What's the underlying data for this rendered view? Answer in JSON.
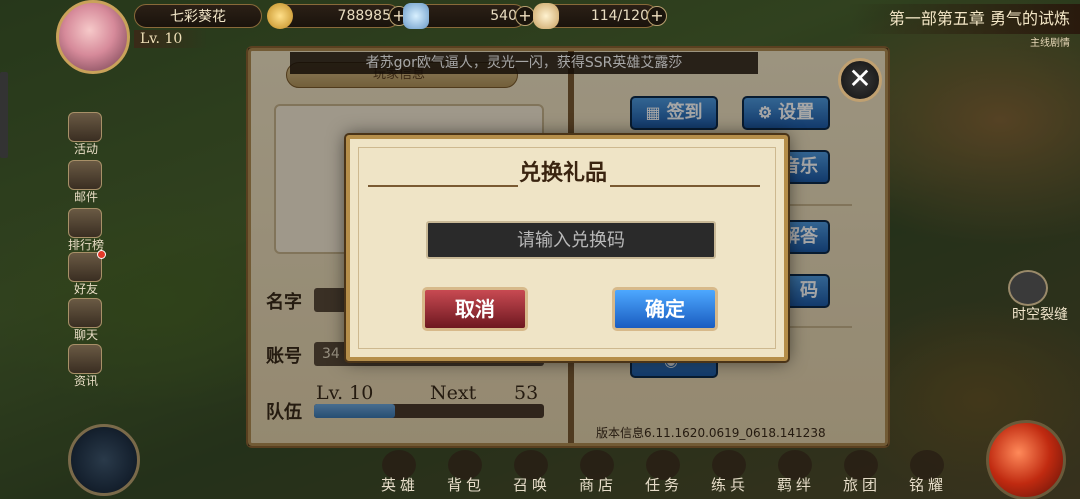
{
  "hud": {
    "player_name": "七彩葵花",
    "level": "Lv. 10",
    "gold": "788985",
    "gems": "540",
    "stamina": "114/120",
    "plus_symbol": "+"
  },
  "chapter": {
    "title": "第一部第五章 勇气的试炼",
    "subtitle": "主线剧情"
  },
  "banner": "者苏gor欧气逼人，灵光一闪，获得SSR英雄艾露莎",
  "side_menu": [
    {
      "label": "活动"
    },
    {
      "label": "邮件"
    },
    {
      "label": "排行榜"
    },
    {
      "label": "好友"
    },
    {
      "label": "聊天"
    },
    {
      "label": "资讯"
    }
  ],
  "bottom_nav": [
    {
      "label": "英雄"
    },
    {
      "label": "背包"
    },
    {
      "label": "召唤"
    },
    {
      "label": "商店"
    },
    {
      "label": "任务"
    },
    {
      "label": "练兵"
    },
    {
      "label": "羁绊"
    },
    {
      "label": "旅团"
    },
    {
      "label": "铭耀"
    }
  ],
  "rift_label": "时空裂缝",
  "panel": {
    "player_info_tab": "玩家信息",
    "name_label": "名字",
    "account_label": "账号",
    "account_value": "34",
    "team_label": "队伍",
    "team_level": "Lv. 10",
    "next_label": "Next",
    "next_value": "53",
    "exp_progress": 0.35,
    "signin_label": "签到",
    "settings_label": "设置",
    "music_label": "音乐",
    "faq_label": "解答",
    "code_label": "码",
    "close_symbol": "✕",
    "version": "版本信息6.11.1620.0619_0618.141238"
  },
  "dialog": {
    "title": "兑换礼品",
    "input_placeholder": "请输入兑换码",
    "cancel_label": "取消",
    "confirm_label": "确定"
  }
}
